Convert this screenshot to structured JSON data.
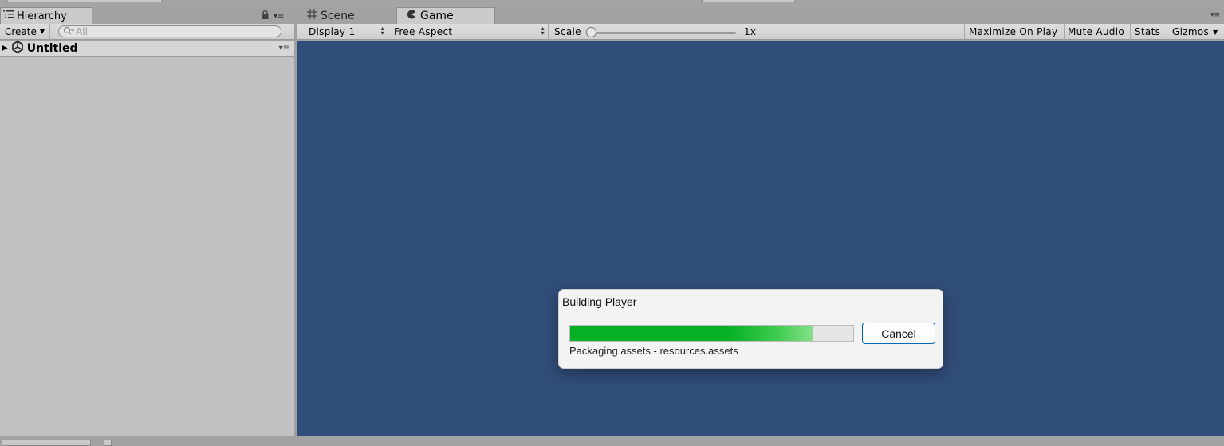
{
  "hierarchy": {
    "tab_label": "Hierarchy",
    "create_label": "Create",
    "search_placeholder": "All",
    "scene_name": "Untitled"
  },
  "game_view": {
    "tabs": [
      {
        "label": "Scene",
        "icon": "grid-icon",
        "active": false
      },
      {
        "label": "Game",
        "icon": "pacman-icon",
        "active": true
      }
    ],
    "display_label": "Display 1",
    "aspect_label": "Free Aspect",
    "scale_label": "Scale",
    "scale_value": "1x",
    "maximize_label": "Maximize On Play",
    "mute_label": "Mute Audio",
    "stats_label": "Stats",
    "gizmos_label": "Gizmos",
    "viewport_color": "#314d79"
  },
  "dialog": {
    "title": "Building Player",
    "cancel_label": "Cancel",
    "status": "Packaging assets - resources.assets",
    "progress": 0.86,
    "progress_color": "#06b025"
  }
}
